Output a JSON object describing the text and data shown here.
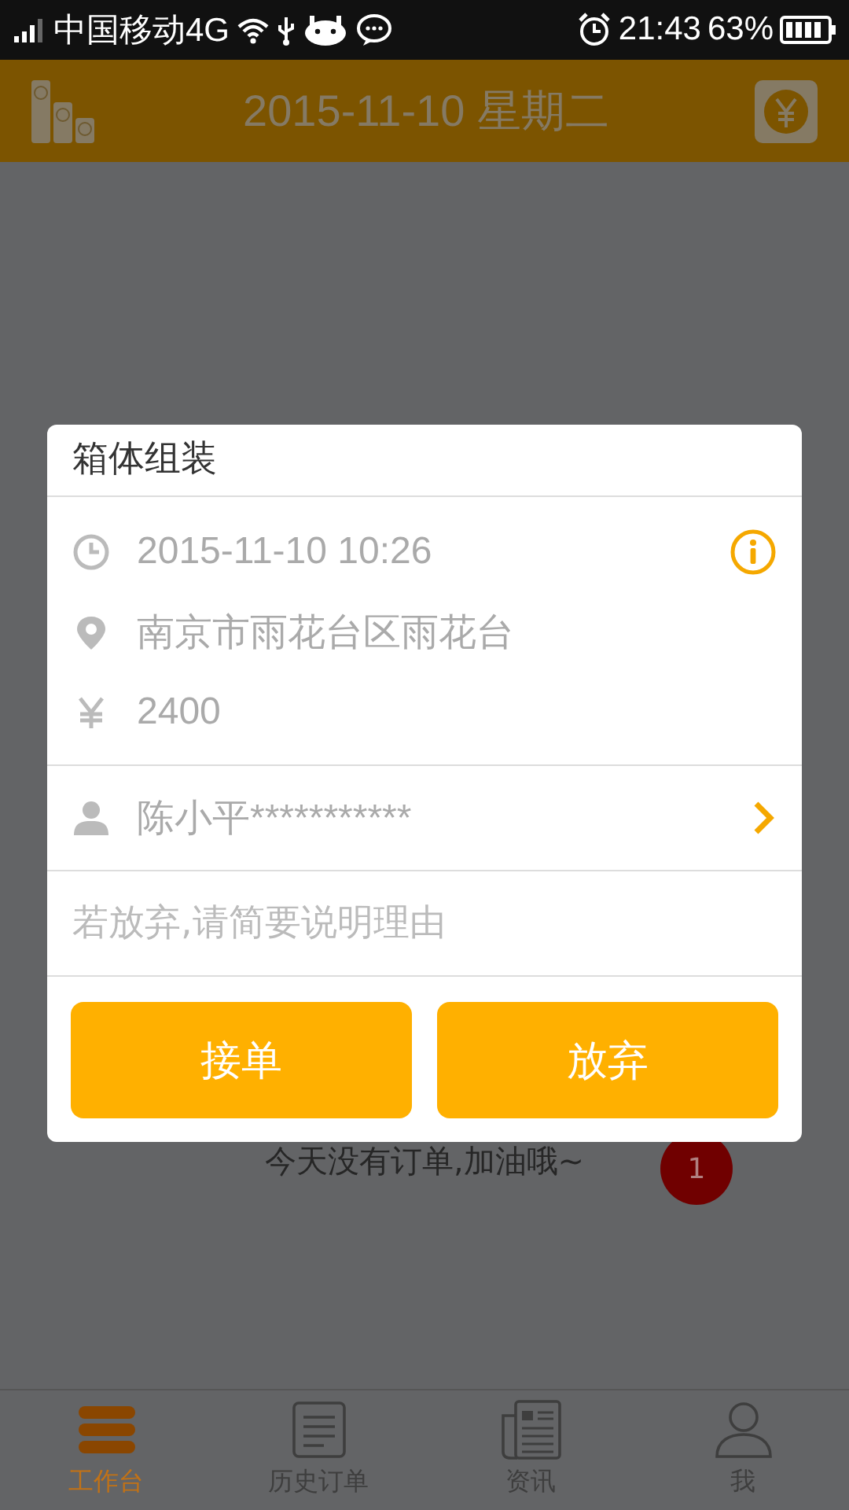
{
  "status_bar": {
    "carrier": "中国移动4G",
    "time": "21:43",
    "battery": "63%"
  },
  "header": {
    "title": "2015-11-10 星期二"
  },
  "page": {
    "empty_message": "今天没有订单,加油哦~",
    "badge": "1"
  },
  "dialog": {
    "title": "箱体组装",
    "details": [
      {
        "kind": "time",
        "text": "2015-11-10 10:26"
      },
      {
        "kind": "location",
        "text": "南京市雨花台区雨花台"
      },
      {
        "kind": "price",
        "text": "2400"
      }
    ],
    "contact": "陈小平***********",
    "reason_placeholder": "若放弃,请简要说明理由",
    "buttons": [
      {
        "label": "接单"
      },
      {
        "label": "放弃"
      }
    ]
  },
  "tabs": [
    {
      "kind": "workbench",
      "label": "工作台",
      "selected": true
    },
    {
      "kind": "history",
      "label": "历史订单",
      "selected": false
    },
    {
      "kind": "news",
      "label": "资讯",
      "selected": false
    },
    {
      "kind": "me",
      "label": "我",
      "selected": false
    }
  ]
}
